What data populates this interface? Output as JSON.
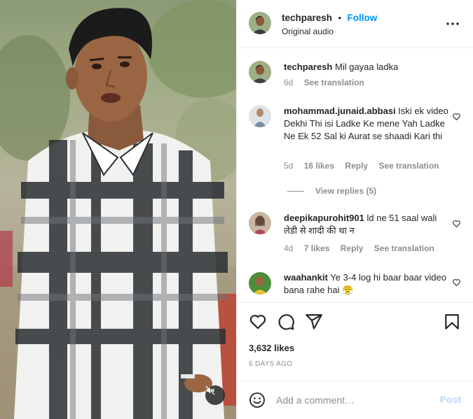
{
  "post": {
    "username": "techparesh",
    "dot": "•",
    "follow_label": "Follow",
    "audio": "Original audio",
    "caption_username": "techparesh",
    "caption_text": "Mil gayaa ladka",
    "caption_time": "6d",
    "caption_translate": "See translation"
  },
  "comments": [
    {
      "username": "mohammad.junaid.abbasi",
      "text": "Iski ek video Dekhi Thi isi Ladke Ke mene Yah Ladke Ne Ek 52 Sal ki Aurat se shaadi Kari thi",
      "time": "5d",
      "likes": "16 likes",
      "reply": "Reply",
      "translate": "See translation",
      "view_replies": "View replies (5)"
    },
    {
      "username": "deepikapurohit901",
      "text": "ld ne 51 saal wali लेडी से शादी की था न",
      "time": "4d",
      "likes": "7 likes",
      "reply": "Reply",
      "translate": "See translation"
    },
    {
      "username": "waahankit",
      "text": "Ye 3-4 log hi baar baar video bana rahe hai 😤"
    }
  ],
  "actions": {
    "likes": "3,632 likes",
    "date": "6 DAYS AGO"
  },
  "composer": {
    "placeholder": "Add a comment…",
    "post_label": "Post"
  },
  "icons": [
    "more-icon",
    "heart-icon",
    "comment-icon",
    "share-icon",
    "save-icon",
    "emoji-icon",
    "mute-icon"
  ],
  "colors": {
    "accent": "#0095f6",
    "post_disabled": "#b3dbff",
    "muted_text": "#8e8e8e",
    "text": "#262626"
  }
}
